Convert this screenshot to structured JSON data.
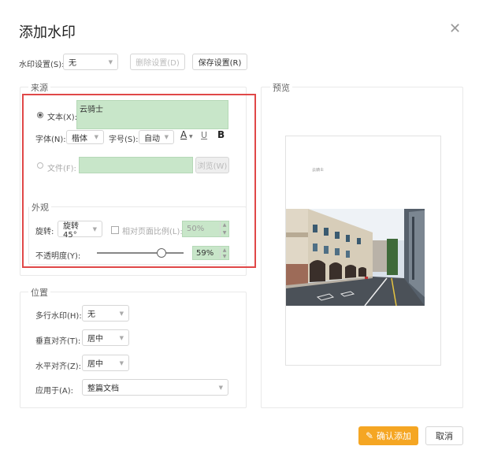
{
  "dialog": {
    "title": "添加水印"
  },
  "settings": {
    "label": "水印设置(S):",
    "value": "无",
    "delete_label": "删除设置(D)",
    "save_label": "保存设置(R)"
  },
  "source": {
    "title": "来源",
    "text_label": "文本(X):",
    "text_value": "云骑士",
    "font_label": "字体(N):",
    "font_value": "楷体",
    "size_label": "字号(S):",
    "size_value": "自动",
    "font_color_glyph": "A",
    "underline_glyph": "U",
    "bold_glyph": "B",
    "file_label": "文件(F):",
    "browse_label": "浏览(W)",
    "selected_source": "text"
  },
  "appearance": {
    "title": "外观",
    "rotate_label": "旋转:",
    "rotate_value": "旋转45°",
    "relative_label": "相对页面比例(L):",
    "relative_value": "50%",
    "opacity_label": "不透明度(Y):",
    "opacity_value": "59%",
    "opacity_fraction": 0.59
  },
  "position": {
    "title": "位置",
    "multi_label": "多行水印(H):",
    "multi_value": "无",
    "valign_label": "垂直对齐(T):",
    "valign_value": "居中",
    "halign_label": "水平对齐(Z):",
    "halign_value": "居中",
    "apply_label": "应用于(A):",
    "apply_value": "整篇文档"
  },
  "preview": {
    "title": "预览",
    "watermark_text": "云骑士"
  },
  "footer": {
    "confirm_label": "确认添加",
    "cancel_label": "取消"
  },
  "colors": {
    "accent": "#f5a623",
    "highlight_box": "#e04848",
    "field_green": "#c8e6c9"
  }
}
